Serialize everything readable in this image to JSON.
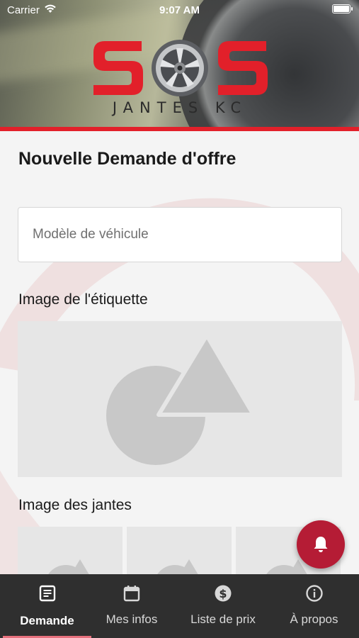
{
  "status_bar": {
    "carrier": "Carrier",
    "time": "9:07 AM"
  },
  "brand": {
    "logo_text": "SOS",
    "subtitle": "JANTES KC",
    "accent_color": "#e2202a"
  },
  "form": {
    "title": "Nouvelle Demande d'offre",
    "vehicle_model": {
      "placeholder": "Modèle de véhicule",
      "value": ""
    },
    "label_image_heading": "Image de l'étiquette",
    "rims_image_heading": "Image des jantes"
  },
  "fab": {
    "icon": "bell-icon",
    "color": "#b51c35"
  },
  "nav": {
    "items": [
      {
        "label": "Demande",
        "icon": "document-icon",
        "active": true
      },
      {
        "label": "Mes infos",
        "icon": "calendar-icon",
        "active": false
      },
      {
        "label": "Liste de prix",
        "icon": "dollar-icon",
        "active": false
      },
      {
        "label": "À propos",
        "icon": "info-icon",
        "active": false
      }
    ]
  }
}
